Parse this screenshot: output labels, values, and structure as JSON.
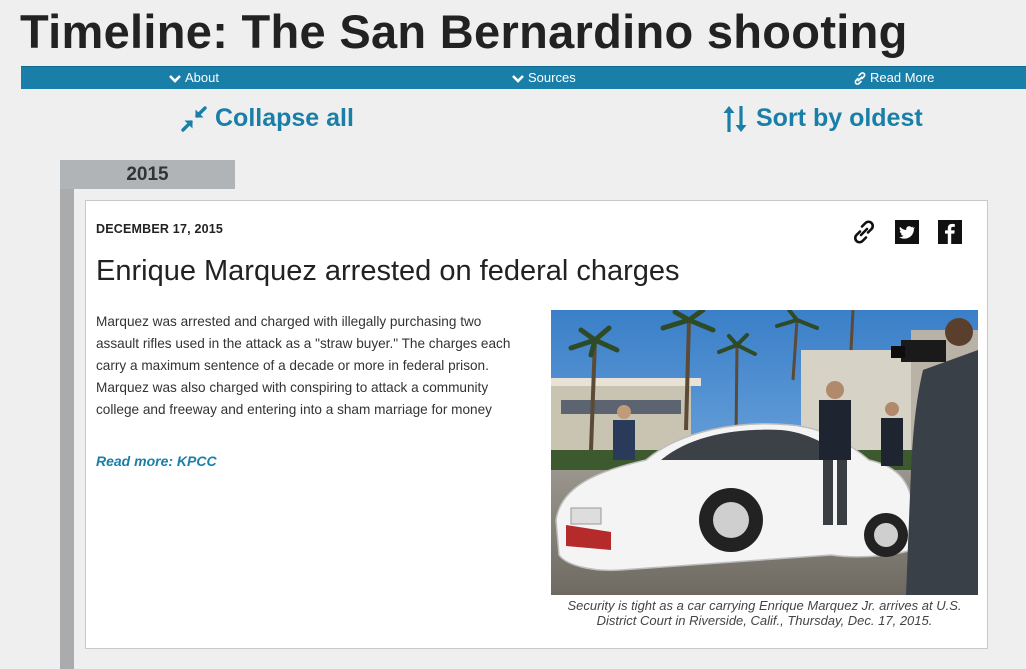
{
  "page": {
    "title": "Timeline: The San Bernardino shooting"
  },
  "nav": {
    "items": [
      {
        "label": "About",
        "icon": "chevron-down-icon"
      },
      {
        "label": "Sources",
        "icon": "chevron-down-icon"
      },
      {
        "label": "Read More",
        "icon": "link-icon"
      }
    ],
    "background_color": "#1a7fa8"
  },
  "controls": {
    "collapse_label": "Collapse all",
    "sort_label": "Sort by oldest",
    "accent_color": "#1a7fa8"
  },
  "timeline": {
    "year": "2015",
    "entry": {
      "date": "DECEMBER 17, 2015",
      "headline": "Enrique Marquez arrested on federal charges",
      "body": "Marquez was arrested and charged with illegally purchasing two assault rifles used in the attack as a \"straw buyer.\" The charges each carry a maximum sentence of a decade or more in federal prison. Marquez was also charged with conspiring to attack a community college and freeway and entering into a sham marriage for money",
      "read_more": "Read more: KPCC",
      "share_icons": [
        "link-icon",
        "twitter-icon",
        "facebook-icon"
      ],
      "photo_caption": "Security is tight as a car carrying Enrique Marquez Jr. arrives at U.S. District Court in Riverside, Calif., Thursday, Dec. 17, 2015."
    }
  }
}
